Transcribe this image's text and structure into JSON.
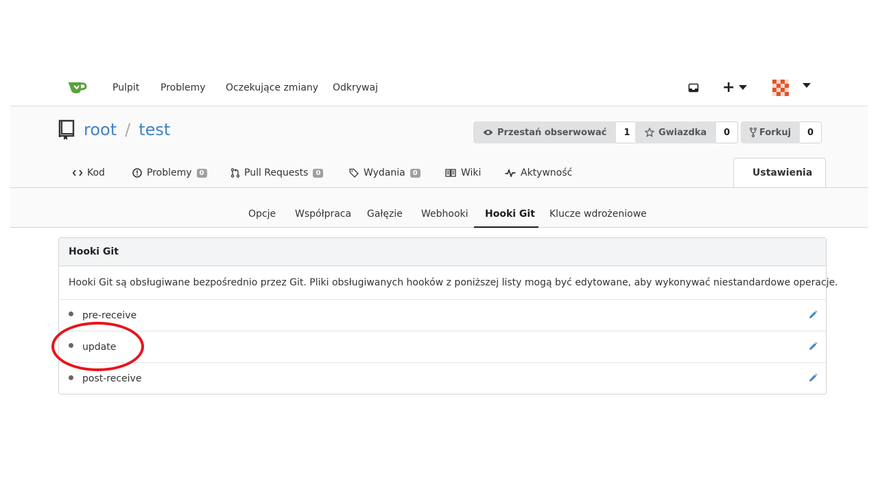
{
  "topnav": {
    "items": [
      "Pulpit",
      "Problemy",
      "Oczekujące zmiany",
      "Odkrywaj"
    ],
    "plus_label": "+",
    "colors": {
      "logo": "#5aa13d"
    }
  },
  "repo": {
    "owner": "root",
    "slash": "/",
    "name": "test",
    "watch": {
      "label": "Przestań obserwować",
      "count": "1"
    },
    "star": {
      "label": "Gwiazdka",
      "count": "0"
    },
    "fork": {
      "label": "Forkuj",
      "count": "0"
    }
  },
  "repo_tabs": {
    "code": "Kod",
    "issues": {
      "label": "Problemy",
      "badge": "0"
    },
    "pulls": {
      "label": "Pull Requests",
      "badge": "0"
    },
    "releases": {
      "label": "Wydania",
      "badge": "0"
    },
    "wiki": "Wiki",
    "activity": "Aktywność",
    "settings": "Ustawienia"
  },
  "subtabs": [
    "Opcje",
    "Współpraca",
    "Gałęzie",
    "Webhooki",
    "Hooki Git",
    "Klucze wdrożeniowe"
  ],
  "active_subtab": "Hooki Git",
  "panel": {
    "title": "Hooki Git",
    "description": "Hooki Git są obsługiwane bezpośrednio przez Git. Pliki obsługiwanych hooków z poniższej listy mogą być edytowane, aby wykonywać niestandardowe operacje.",
    "hooks": [
      "pre-receive",
      "update",
      "post-receive"
    ]
  },
  "annotation": {
    "highlighted_hook": "update",
    "color": "#e8141b"
  }
}
